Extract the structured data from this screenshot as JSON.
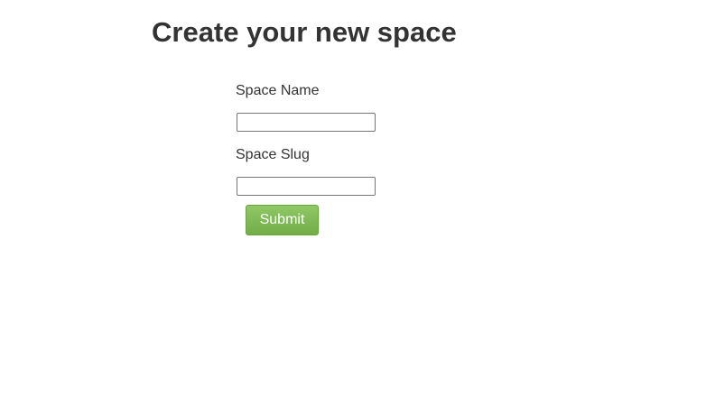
{
  "page": {
    "title": "Create your new space"
  },
  "form": {
    "space_name": {
      "label": "Space Name",
      "value": ""
    },
    "space_slug": {
      "label": "Space Slug",
      "value": ""
    },
    "submit_label": "Submit"
  },
  "colors": {
    "text": "#333333",
    "button_green": "#7ab851",
    "button_text": "#ffffff"
  }
}
